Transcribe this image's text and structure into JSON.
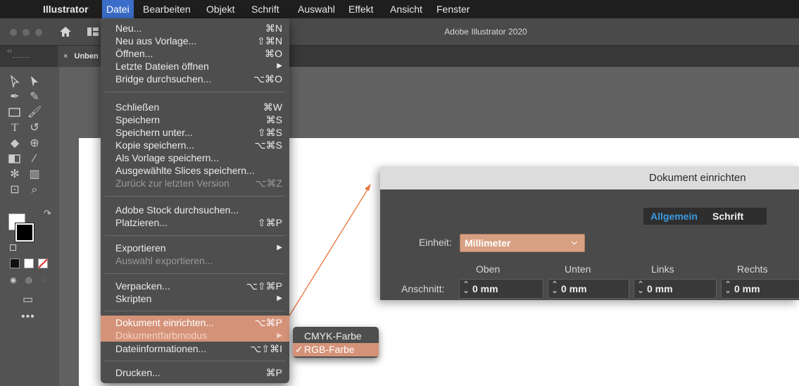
{
  "menubar": {
    "app_name": "Illustrator",
    "items": [
      "Datei",
      "Bearbeiten",
      "Objekt",
      "Schrift",
      "Auswahl",
      "Effekt",
      "Ansicht",
      "Fenster"
    ]
  },
  "window": {
    "title": "Adobe Illustrator 2020"
  },
  "document_tab": {
    "close": "×",
    "label": "Unben"
  },
  "file_menu": {
    "items": [
      {
        "label": "Neu...",
        "shortcut": "⌘N"
      },
      {
        "label": "Neu aus Vorlage...",
        "shortcut": "⇧⌘N"
      },
      {
        "label": "Öffnen...",
        "shortcut": "⌘O"
      },
      {
        "label": "Letzte Dateien öffnen",
        "shortcut": "▶"
      },
      {
        "label": "Bridge durchsuchen...",
        "shortcut": "⌥⌘O"
      },
      {
        "label": "Schließen",
        "shortcut": "⌘W"
      },
      {
        "label": "Speichern",
        "shortcut": "⌘S"
      },
      {
        "label": "Speichern unter...",
        "shortcut": "⇧⌘S"
      },
      {
        "label": "Kopie speichern...",
        "shortcut": "⌥⌘S"
      },
      {
        "label": "Als Vorlage speichern...",
        "shortcut": ""
      },
      {
        "label": "Ausgewählte Slices speichern...",
        "shortcut": ""
      },
      {
        "label": "Zurück zur letzten Version",
        "shortcut": "⌥⌘Z"
      },
      {
        "label": "Adobe Stock durchsuchen...",
        "shortcut": ""
      },
      {
        "label": "Platzieren...",
        "shortcut": "⇧⌘P"
      },
      {
        "label": "Exportieren",
        "shortcut": "▶"
      },
      {
        "label": "Auswahl exportieren...",
        "shortcut": ""
      },
      {
        "label": "Verpacken...",
        "shortcut": "⌥⇧⌘P"
      },
      {
        "label": "Skripten",
        "shortcut": "▶"
      },
      {
        "label": "Dokument einrichten...",
        "shortcut": "⌥⌘P"
      },
      {
        "label": "Dokumentfarbmodus",
        "shortcut": "▶"
      },
      {
        "label": "Dateiinformationen...",
        "shortcut": "⌥⇧⌘I"
      },
      {
        "label": "Drucken...",
        "shortcut": "⌘P"
      }
    ]
  },
  "color_mode_submenu": {
    "items": [
      {
        "check": "",
        "label": "CMYK-Farbe"
      },
      {
        "check": "✓",
        "label": "RGB-Farbe"
      }
    ]
  },
  "document_setup_dialog": {
    "title": "Dokument einrichten",
    "tabs": [
      "Allgemein",
      "Schrift"
    ],
    "unit_label": "Einheit:",
    "unit_value": "Millimeter",
    "bleed_label": "Anschnitt:",
    "columns": [
      "Oben",
      "Unten",
      "Links",
      "Rechts"
    ],
    "values": [
      "0 mm",
      "0 mm",
      "0 mm",
      "0 mm"
    ]
  },
  "colors": {
    "menu_bg": "#4e4e4e",
    "highlight": "#d49278",
    "menubar_active": "#3b6dc9",
    "dialog_tab_active": "#3b9be0",
    "annotation_arrow": "#e8743b"
  }
}
